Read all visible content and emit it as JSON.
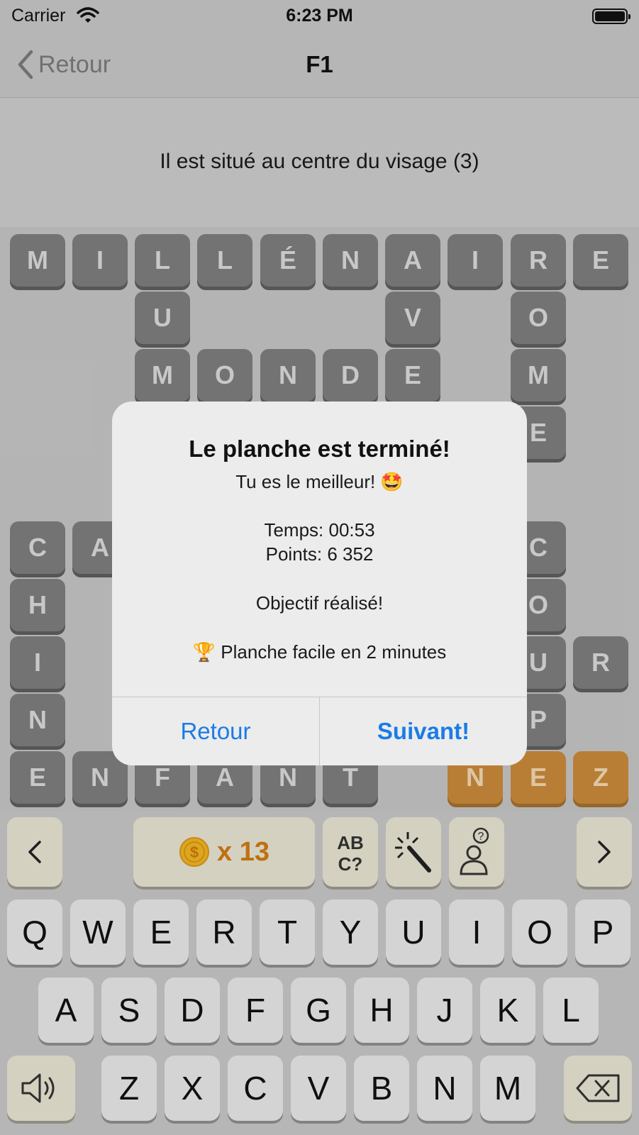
{
  "status_bar": {
    "carrier": "Carrier",
    "time": "6:23 PM"
  },
  "nav": {
    "back_label": "Retour",
    "title": "F1"
  },
  "clue": {
    "text": "Il est situé au centre du visage (3)"
  },
  "grid": {
    "row1": [
      "M",
      "I",
      "L",
      "L",
      "É",
      "N",
      "A",
      "I",
      "R",
      "E"
    ],
    "col_u": [
      "U"
    ],
    "col_v": [
      "V"
    ],
    "col_o": [
      "O"
    ],
    "row3": [
      "M",
      "O",
      "N",
      "D",
      "E"
    ],
    "col_m": [
      "M"
    ],
    "col_e": [
      "E"
    ],
    "chine": [
      "C",
      "H",
      "I",
      "N",
      "E"
    ],
    "ca_second": [
      "A"
    ],
    "coup": [
      "C",
      "O",
      "U",
      "P"
    ],
    "r_tile": [
      "R"
    ],
    "enfant": [
      "N",
      "F",
      "A",
      "N",
      "T"
    ],
    "nez": [
      "N",
      "E",
      "Z"
    ]
  },
  "alert": {
    "title": "Le planche est terminé!",
    "subtitle": "Tu es le meilleur! 🤩",
    "time_line": "Temps: 00:53",
    "points_line": "Points: 6 352",
    "objective_line": "Objectif réalisé!",
    "achievement": "🏆 Planche facile en 2 minutes",
    "btn_back": "Retour",
    "btn_next": "Suivant!"
  },
  "toolbar": {
    "prev": "<",
    "next": ">",
    "coin_count": "x 13",
    "letters_hint": "AB\nC?"
  },
  "keyboard": {
    "row1": [
      "Q",
      "W",
      "E",
      "R",
      "T",
      "Y",
      "U",
      "I",
      "O",
      "P"
    ],
    "row2": [
      "A",
      "S",
      "D",
      "F",
      "G",
      "H",
      "J",
      "K",
      "L"
    ],
    "row3": [
      "Z",
      "X",
      "C",
      "V",
      "B",
      "N",
      "M"
    ]
  },
  "colors": {
    "tile": "#7d7d7d",
    "highlight": "#c9893a",
    "link": "#1a7ce6",
    "coin": "#d07a12"
  }
}
